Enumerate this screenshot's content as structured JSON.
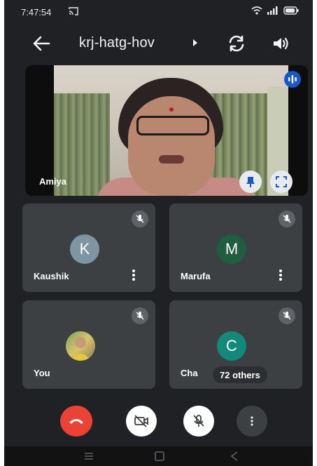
{
  "status_bar": {
    "time": "7:47:54",
    "icons": [
      "cast-icon",
      "wifi-icon",
      "signal-icon",
      "battery-icon"
    ]
  },
  "toolbar": {
    "meeting_code": "krj-hatg-hov",
    "back_icon": "arrow-back-icon",
    "switch_camera_icon": "switch-camera-icon",
    "speaker_icon": "speaker-icon"
  },
  "main_tile": {
    "participant_name": "Amiya"
  },
  "tiles": [
    {
      "name": "Kaushik",
      "avatar_letter": "K",
      "avatar_color": "#7f95a3",
      "muted": true
    },
    {
      "name": "Marufa",
      "avatar_letter": "M",
      "avatar_color": "#1f5f3f",
      "muted": true
    },
    {
      "name": "You",
      "avatar_type": "photo",
      "muted": true
    },
    {
      "name": "Cha",
      "avatar_letter": "C",
      "avatar_color": "#12897a",
      "muted": true,
      "others_label": "72 others"
    }
  ],
  "controls": [
    "end-call-icon",
    "camera-off-icon",
    "mic-off-icon",
    "more-options-icon"
  ],
  "colors": {
    "background": "#202124",
    "tile": "#3c4043",
    "end_call": "#ea4335",
    "speaking": "#1a57c8"
  }
}
